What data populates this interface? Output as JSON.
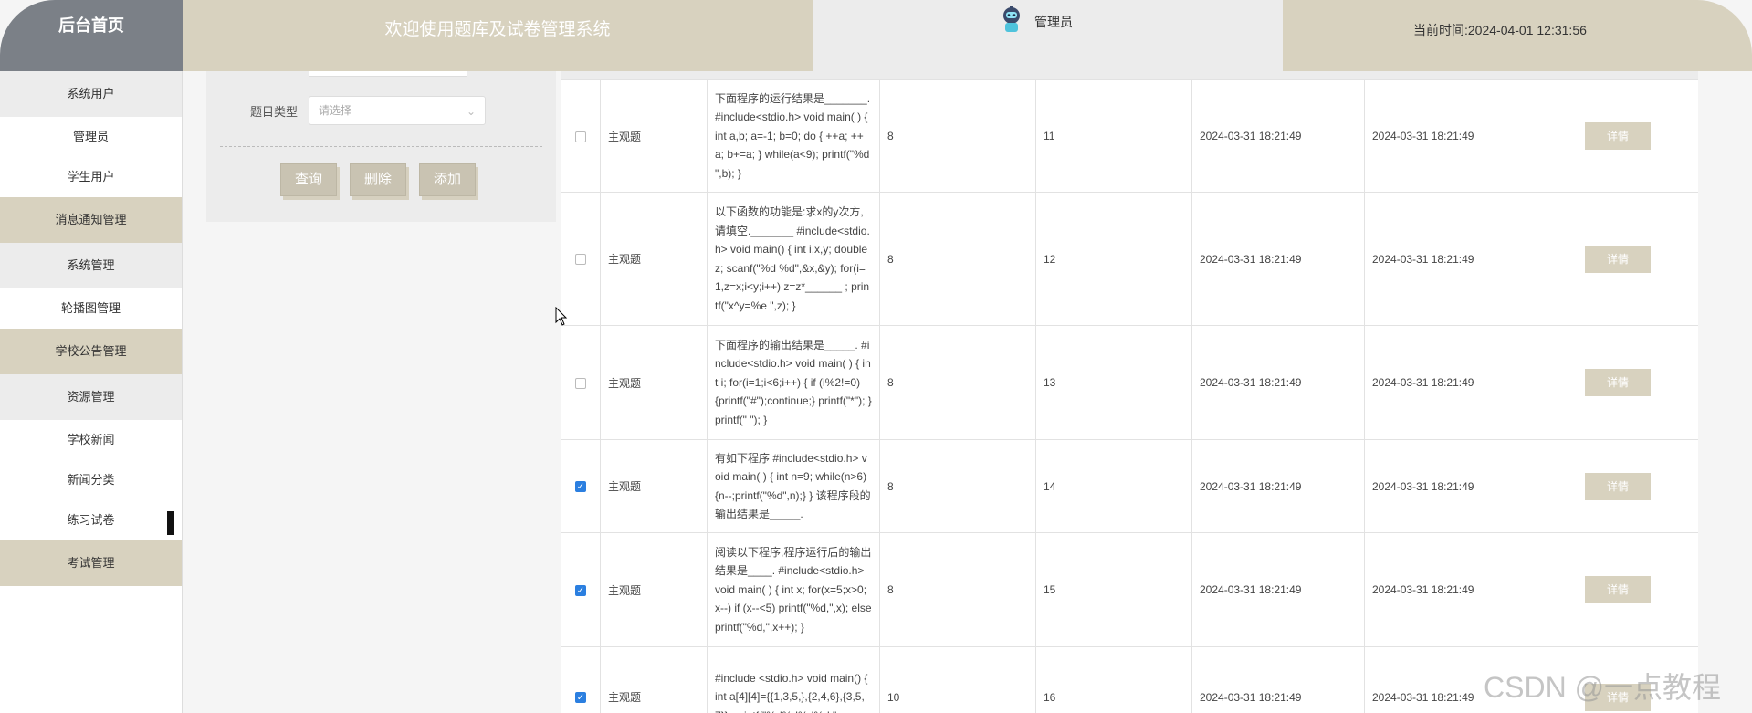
{
  "header": {
    "home": "后台首页",
    "welcome": "欢迎使用题库及试卷管理系统",
    "user": "管理员",
    "time_label": "当前时间:2024-04-01 12:31:56"
  },
  "sidebar": {
    "items": [
      {
        "label": "系统用户"
      },
      {
        "label": "管理员"
      },
      {
        "label": "学生用户"
      },
      {
        "label": "消息通知管理"
      },
      {
        "label": "系统管理"
      },
      {
        "label": "轮播图管理"
      },
      {
        "label": "学校公告管理"
      },
      {
        "label": "资源管理"
      },
      {
        "label": "学校新闻"
      },
      {
        "label": "新闻分类"
      },
      {
        "label": "练习试卷"
      },
      {
        "label": "考试管理"
      }
    ]
  },
  "filter": {
    "type_label": "题目类型",
    "type_placeholder": "请选择",
    "query": "查询",
    "delete": "删除",
    "add": "添加"
  },
  "table": {
    "rows": [
      {
        "checked": false,
        "type": "主观题",
        "question": "下面程序的运行结果是_______. #include<stdio.h> void main( ) { int a,b; a=-1; b=0; do { ++a; ++a; b+=a; } while(a<9); printf(\"%d \",b); }",
        "score": "8",
        "order": "11",
        "created": "2024-03-31 18:21:49",
        "updated": "2024-03-31 18:21:49",
        "action": "详情"
      },
      {
        "checked": false,
        "type": "主观题",
        "question": "以下函数的功能是:求x的y次方,请填空._______ #include<stdio.h> void main() { int i,x,y; double z; scanf(\"%d %d\",&x,&y); for(i=1,z=x;i<y;i++) z=z*______ ; printf(\"x^y=%e \",z); }",
        "score": "8",
        "order": "12",
        "created": "2024-03-31 18:21:49",
        "updated": "2024-03-31 18:21:49",
        "action": "详情"
      },
      {
        "checked": false,
        "type": "主观题",
        "question": "下面程序的输出结果是_____. #include<stdio.h> void main( ) { int i; for(i=1;i<6;i++) { if (i%2!=0) {printf(\"#\");continue;} printf(\"*\"); } printf(\" \"); }",
        "score": "8",
        "order": "13",
        "created": "2024-03-31 18:21:49",
        "updated": "2024-03-31 18:21:49",
        "action": "详情"
      },
      {
        "checked": true,
        "type": "主观题",
        "question": "有如下程序 #include<stdio.h> void main( ) { int n=9; while(n>6) {n--;printf(\"%d\",n);} } 该程序段的输出结果是_____.",
        "score": "8",
        "order": "14",
        "created": "2024-03-31 18:21:49",
        "updated": "2024-03-31 18:21:49",
        "action": "详情"
      },
      {
        "checked": true,
        "type": "主观题",
        "question": "阅读以下程序,程序运行后的输出结果是____. #include<stdio.h> void main( ) { int x; for(x=5;x>0;x--) if (x--<5) printf(\"%d,\",x); else printf(\"%d,\",x++); }",
        "score": "8",
        "order": "15",
        "created": "2024-03-31 18:21:49",
        "updated": "2024-03-31 18:21:49",
        "action": "详情"
      },
      {
        "checked": true,
        "type": "主观题",
        "question": "#include <stdio.h> void main() { int a[4][4]={{1,3,5,},{2,4,6},{3,5,7}}; printf(\"%d%d%d%d \",a",
        "score": "10",
        "order": "16",
        "created": "2024-03-31 18:21:49",
        "updated": "2024-03-31 18:21:49",
        "action": "详情"
      }
    ]
  },
  "watermark": "CSDN @一点教程"
}
